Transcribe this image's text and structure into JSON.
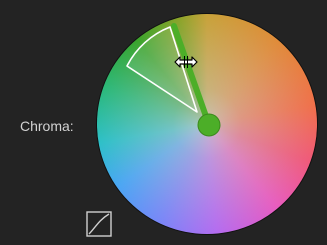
{
  "chroma": {
    "label": "Chroma:"
  },
  "icons": {
    "resize_cursor": "horizontal-resize-cursor-icon",
    "curve": "curve-toggle-icon"
  },
  "colors": {
    "background": "#232323",
    "label": "#d2d2d2",
    "handle": "#4cae28",
    "arc": "#ffffff"
  }
}
